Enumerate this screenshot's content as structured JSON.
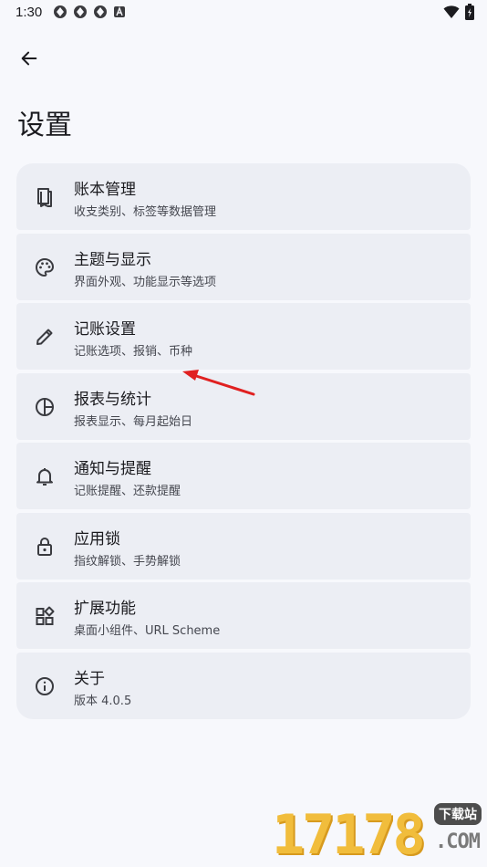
{
  "status_bar": {
    "time": "1:30"
  },
  "header": {
    "title": "设置"
  },
  "settings": {
    "items": [
      {
        "title": "账本管理",
        "subtitle": "收支类别、标签等数据管理",
        "icon": "book-icon"
      },
      {
        "title": "主题与显示",
        "subtitle": "界面外观、功能显示等选项",
        "icon": "palette-icon"
      },
      {
        "title": "记账设置",
        "subtitle": "记账选项、报销、币种",
        "icon": "pencil-icon"
      },
      {
        "title": "报表与统计",
        "subtitle": "报表显示、每月起始日",
        "icon": "pie-chart-icon"
      },
      {
        "title": "通知与提醒",
        "subtitle": "记账提醒、还款提醒",
        "icon": "bell-icon"
      },
      {
        "title": "应用锁",
        "subtitle": "指纹解锁、手势解锁",
        "icon": "lock-icon"
      },
      {
        "title": "扩展功能",
        "subtitle": "桌面小组件、URL Scheme",
        "icon": "widgets-icon"
      },
      {
        "title": "关于",
        "subtitle": "版本 4.0.5",
        "icon": "info-icon"
      }
    ]
  },
  "watermark": {
    "digits": "17178",
    "badge": "下载站",
    "domain": ".COM"
  },
  "colors": {
    "background": "#f7f8fc",
    "card": "#eceef4",
    "text_primary": "#1b1b1f",
    "text_secondary": "#45474f",
    "annotation_arrow": "#e02020"
  }
}
